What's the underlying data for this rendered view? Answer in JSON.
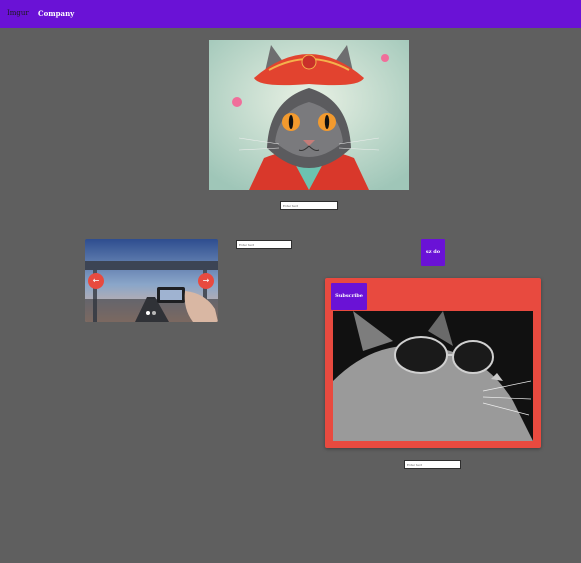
{
  "header": {
    "brand": "Imgur",
    "company": "Company"
  },
  "hero_image": {
    "alt": "Cat wearing red hat and robe",
    "icon": "cat-portrait-image"
  },
  "inputs": {
    "placeholder": "Enter text"
  },
  "carousel": {
    "prev_label": "←",
    "next_label": "→",
    "slides": 2,
    "active_slide": 1,
    "dot_active_color": "#ffffff",
    "dot_inactive_color": "#b8b8b8"
  },
  "small_button": {
    "label": "sz do"
  },
  "card": {
    "subscribe_label": "Subscribe",
    "image_alt": "Cat wearing sunglasses"
  },
  "colors": {
    "background": "#5f5f5f",
    "accent": "#6a12d6",
    "card": "#e84a3f"
  }
}
